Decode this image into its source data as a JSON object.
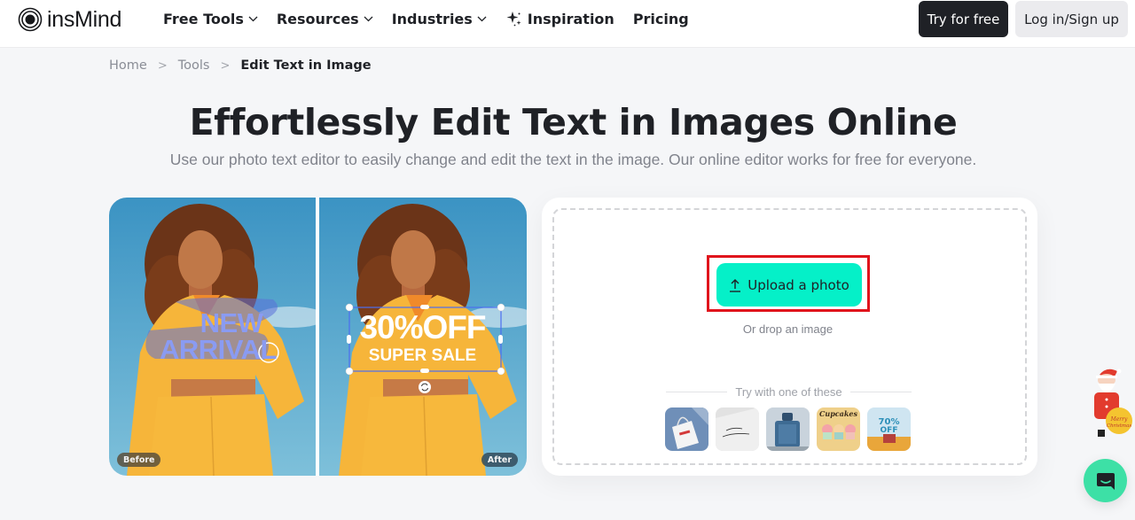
{
  "header": {
    "logo_text": "insMind",
    "nav": [
      {
        "label": "Free Tools",
        "has_dropdown": true
      },
      {
        "label": "Resources",
        "has_dropdown": true
      },
      {
        "label": "Industries",
        "has_dropdown": true
      },
      {
        "label": "Inspiration",
        "icon": "sparkle-icon"
      },
      {
        "label": "Pricing"
      }
    ],
    "try_button": "Try for free",
    "login_button": "Log in/Sign up"
  },
  "breadcrumb": {
    "items": [
      "Home",
      "Tools"
    ],
    "separator": ">",
    "current": "Edit Text in Image"
  },
  "hero": {
    "title": "Effortlessly Edit Text in Images Online",
    "subtitle": "Use our photo text editor to easily change and edit the text in the image. Our online editor works for free for everyone."
  },
  "demo": {
    "before_label": "Before",
    "after_label": "After",
    "before_text_line1": "NEW",
    "before_text_line2": "ARRIVAL",
    "after_text_line1": "30%OFF",
    "after_text_line2": "SUPER SALE"
  },
  "upload": {
    "button_label": "Upload a photo",
    "drop_hint": "Or drop an image",
    "samples_label": "Try with one of these",
    "samples": [
      {
        "name": "tote-bag",
        "text": ""
      },
      {
        "name": "card-script",
        "text": "Happy Father's Day"
      },
      {
        "name": "perfume-bottle",
        "text": ""
      },
      {
        "name": "cupcakes",
        "text": "Cupcakes"
      },
      {
        "name": "autumn-sale",
        "text": "70% OFF"
      }
    ]
  },
  "colors": {
    "accent": "#05f0c8",
    "highlight_box": "#e0141c",
    "dark_button": "#1f2126",
    "chat_bubble": "#3de0a6"
  }
}
